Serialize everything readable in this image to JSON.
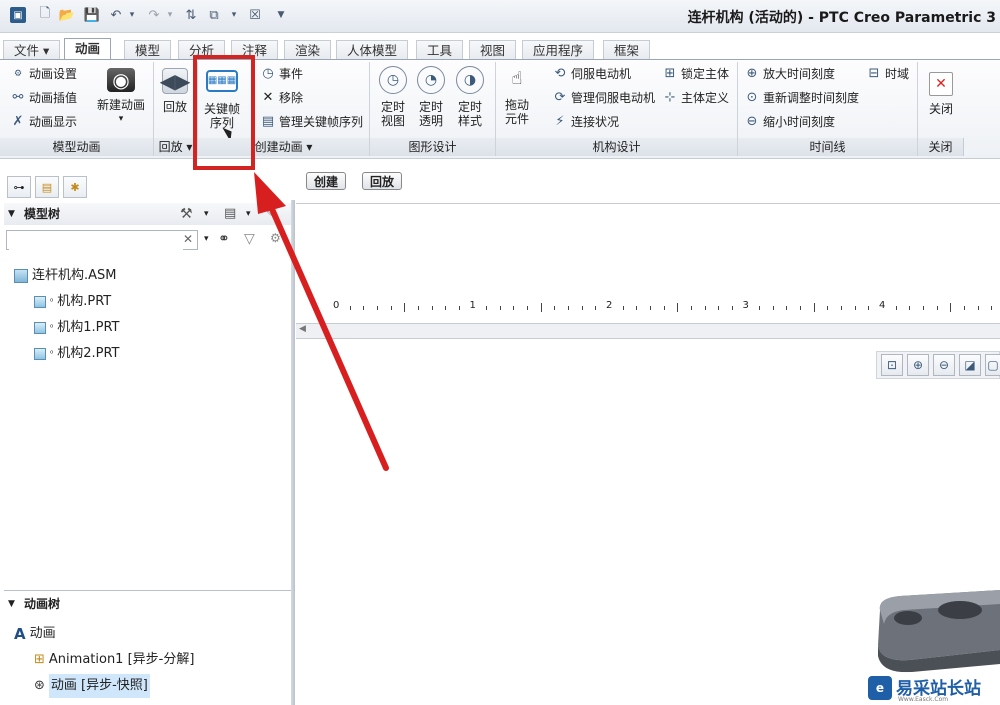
{
  "window": {
    "title": "连杆机构 (活动的) - PTC Creo Parametric 3"
  },
  "quick_access": {
    "icons": [
      "app-icon",
      "new-icon",
      "open-icon",
      "save-icon",
      "undo-icon",
      "redo-icon",
      "regenerate-icon",
      "windows-icon",
      "close-window-icon",
      "customize-icon"
    ]
  },
  "tabs": [
    {
      "label": "文件 ▾"
    },
    {
      "label": "动画"
    },
    {
      "label": "模型"
    },
    {
      "label": "分析"
    },
    {
      "label": "注释"
    },
    {
      "label": "渲染"
    },
    {
      "label": "人体模型"
    },
    {
      "label": "工具"
    },
    {
      "label": "视图"
    },
    {
      "label": "应用程序"
    },
    {
      "label": "框架"
    }
  ],
  "ribbon": {
    "model_animation": {
      "items": [
        "动画设置",
        "动画插值",
        "动画显示"
      ],
      "new_animation": "新建动画",
      "group": "模型动画"
    },
    "playback": {
      "label": "回放",
      "group": "回放 ▾"
    },
    "create_animation": {
      "keyframe_line1": "关键帧",
      "keyframe_line2": "序列",
      "event": "事件",
      "remove": "移除",
      "manage_keyframe": "管理关键帧序列",
      "group": "创建动画 ▾"
    },
    "graphic_design": {
      "timed_view": [
        "定时",
        "视图"
      ],
      "timed_transparency": [
        "定时",
        "透明"
      ],
      "timed_style": [
        "定时",
        "样式"
      ],
      "group": "图形设计"
    },
    "mechanism": {
      "drag_line1": "拖动",
      "drag_line2": "元件",
      "servo": "伺服电动机",
      "manage_servo": "管理伺服电动机",
      "connection_status": "连接状况",
      "lock_body": "锁定主体",
      "body_definition": "主体定义",
      "group": "机构设计"
    },
    "timeline": {
      "zoom_in": "放大时间刻度",
      "readjust": "重新调整时间刻度",
      "zoom_out": "缩小时间刻度",
      "time_domain": "时域",
      "group": "时间线"
    },
    "close": {
      "label": "关闭",
      "group": "关闭"
    }
  },
  "model_tree": {
    "title": "模型树",
    "search_placeholder": "",
    "items": [
      {
        "label": "连杆机构.ASM",
        "level": 0
      },
      {
        "label": "机构.PRT",
        "level": 1
      },
      {
        "label": "机构1.PRT",
        "level": 1
      },
      {
        "label": "机构2.PRT",
        "level": 1
      }
    ]
  },
  "animation_tree": {
    "title": "动画树",
    "items": [
      {
        "label": "动画",
        "level": 0
      },
      {
        "label": "Animation1 [异步-分解]",
        "level": 1
      },
      {
        "label": "动画 [异步-快照]",
        "level": 1,
        "selected": true
      }
    ]
  },
  "timeline_panel": {
    "create_button": "创建",
    "playback_button": "回放",
    "ruler_numbers": [
      "0",
      "1",
      "2",
      "3",
      "4"
    ]
  },
  "watermark": {
    "text": "易采站长站",
    "sub": "Www.Easck.Com"
  },
  "colors": {
    "highlight": "#d32424",
    "arrow": "#d81f1f",
    "selected_bg": "#cfe6fb"
  }
}
